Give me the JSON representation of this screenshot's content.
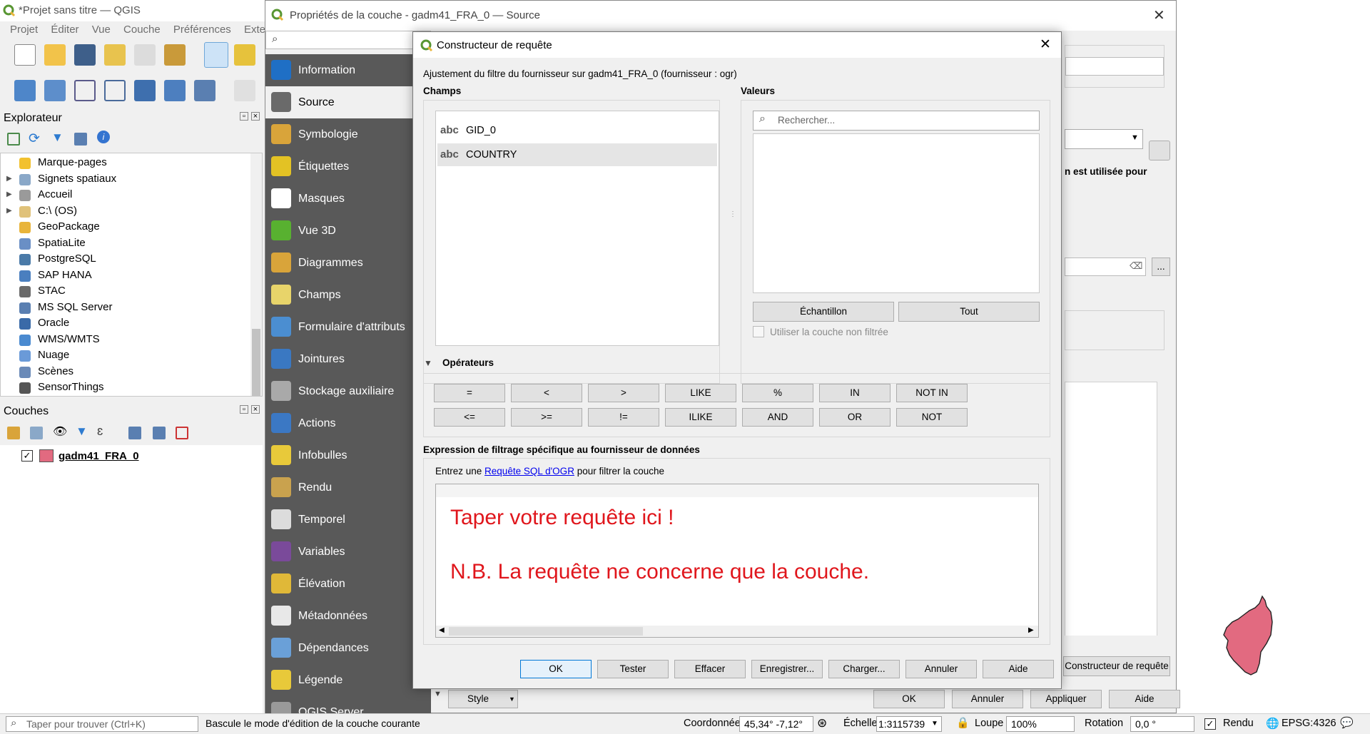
{
  "main": {
    "title": "*Projet sans titre — QGIS",
    "menu": [
      "Projet",
      "Éditer",
      "Vue",
      "Couche",
      "Préférences",
      "Extens"
    ],
    "browser": {
      "title": "Explorateur",
      "items": [
        {
          "label": "Marque-pages",
          "icon": "star-icon",
          "expandable": false
        },
        {
          "label": "Signets spatiaux",
          "icon": "bookmark-icon",
          "expandable": true
        },
        {
          "label": "Accueil",
          "icon": "home-folder-icon",
          "expandable": true
        },
        {
          "label": "C:\\ (OS)",
          "icon": "drive-icon",
          "expandable": true
        },
        {
          "label": "GeoPackage",
          "icon": "geopackage-icon",
          "expandable": false
        },
        {
          "label": "SpatiaLite",
          "icon": "spatialite-icon",
          "expandable": false
        },
        {
          "label": "PostgreSQL",
          "icon": "postgresql-icon",
          "expandable": false
        },
        {
          "label": "SAP HANA",
          "icon": "sap-hana-icon",
          "expandable": false
        },
        {
          "label": "STAC",
          "icon": "stac-icon",
          "expandable": false
        },
        {
          "label": "MS SQL Server",
          "icon": "mssql-icon",
          "expandable": false
        },
        {
          "label": "Oracle",
          "icon": "oracle-icon",
          "expandable": false
        },
        {
          "label": "WMS/WMTS",
          "icon": "wms-icon",
          "expandable": false
        },
        {
          "label": "Nuage",
          "icon": "cloud-icon",
          "expandable": false
        },
        {
          "label": "Scènes",
          "icon": "scenes-icon",
          "expandable": false
        },
        {
          "label": "SensorThings",
          "icon": "sensorthings-icon",
          "expandable": false
        }
      ]
    },
    "layers": {
      "title": "Couches",
      "items": [
        {
          "label": "gadm41_FRA_0",
          "checked": true,
          "color": "#e26a80"
        }
      ]
    }
  },
  "props": {
    "title": "Propriétés de la couche - gadm41_FRA_0 — Source",
    "side_items": [
      {
        "label": "Information",
        "icon": "information-icon",
        "color": "#1f6fc5"
      },
      {
        "label": "Source",
        "icon": "source-icon",
        "color": "#6a6a6a",
        "active": true
      },
      {
        "label": "Symbologie",
        "icon": "symbology-icon",
        "color": "#d9a43a"
      },
      {
        "label": "Étiquettes",
        "icon": "labels-icon",
        "color": "#e3c224"
      },
      {
        "label": "Masques",
        "icon": "masks-icon",
        "color": "#ffffff"
      },
      {
        "label": "Vue 3D",
        "icon": "cube-3d-icon",
        "color": "#58b130"
      },
      {
        "label": "Diagrammes",
        "icon": "diagram-icon",
        "color": "#d9a43a"
      },
      {
        "label": "Champs",
        "icon": "fields-icon",
        "color": "#e8d46a"
      },
      {
        "label": "Formulaire d'attributs",
        "icon": "form-icon",
        "color": "#4b8ed1"
      },
      {
        "label": "Jointures",
        "icon": "joins-icon",
        "color": "#3a78c2"
      },
      {
        "label": "Stockage auxiliaire",
        "icon": "storage-icon",
        "color": "#a9a9a9"
      },
      {
        "label": "Actions",
        "icon": "actions-icon",
        "color": "#3b78c4"
      },
      {
        "label": "Infobulles",
        "icon": "tooltip-icon",
        "color": "#e8c93a"
      },
      {
        "label": "Rendu",
        "icon": "render-brush-icon",
        "color": "#c9a24e"
      },
      {
        "label": "Temporel",
        "icon": "clock-icon",
        "color": "#dcdcdc"
      },
      {
        "label": "Variables",
        "icon": "variables-icon",
        "color": "#7a4a9a"
      },
      {
        "label": "Élévation",
        "icon": "elevation-icon",
        "color": "#e0b838"
      },
      {
        "label": "Métadonnées",
        "icon": "metadata-icon",
        "color": "#e8e8e8"
      },
      {
        "label": "Dépendances",
        "icon": "dependencies-icon",
        "color": "#6aa0d8"
      },
      {
        "label": "Légende",
        "icon": "legend-icon",
        "color": "#e8c93a"
      },
      {
        "label": "QGIS Server",
        "icon": "server-icon",
        "color": "#9a9a9a"
      }
    ],
    "right_partial": {
      "text": "n est utilisée pour",
      "query_builder_btn": "Constructeur de requête",
      "ellipsis": "..."
    },
    "footer": {
      "style": "Style",
      "ok": "OK",
      "cancel": "Annuler",
      "apply": "Appliquer",
      "help": "Aide"
    }
  },
  "qb": {
    "title": "Constructeur de requête",
    "subtitle": "Ajustement du filtre du fournisseur sur gadm41_FRA_0 (fournisseur : ogr)",
    "fields_title": "Champs",
    "fields": [
      {
        "type": "abc",
        "name": "GID_0"
      },
      {
        "type": "abc",
        "name": "COUNTRY"
      }
    ],
    "values_title": "Valeurs",
    "search_placeholder": "Rechercher...",
    "sample": "Échantillon",
    "all": "Tout",
    "unfiltered": "Utiliser la couche non filtrée",
    "operators_title": "Opérateurs",
    "operators_row1": [
      "=",
      "<",
      ">",
      "LIKE",
      "%",
      "IN",
      "NOT IN"
    ],
    "operators_row2": [
      "<=",
      ">=",
      "!=",
      "ILIKE",
      "AND",
      "OR",
      "NOT"
    ],
    "expr_title": "Expression de filtrage spécifique au fournisseur de données",
    "expr_hint_pre": "Entrez une ",
    "expr_hint_link": "Requête SQL d'OGR",
    "expr_hint_post": " pour filtrer la couche",
    "annot_line1": "Taper votre requête ici !",
    "annot_line2": "N.B. La requête ne concerne que la couche.",
    "annot_color": "#e0161c",
    "buttons": {
      "ok": "OK",
      "test": "Tester",
      "clear": "Effacer",
      "save": "Enregistrer...",
      "load": "Charger...",
      "cancel": "Annuler",
      "help": "Aide"
    }
  },
  "status": {
    "search_placeholder": "Taper pour trouver (Ctrl+K)",
    "message": "Bascule le mode d'édition de la couche courante",
    "coord_label": "Coordonnée",
    "coord_value": "45,34° -7,12°",
    "scale_label": "Échelle",
    "scale_value": "1:3115739",
    "magnifier_label": "Loupe",
    "magnifier_value": "100%",
    "rotation_label": "Rotation",
    "rotation_value": "0,0 °",
    "render_label": "Rendu",
    "render_checked": true,
    "crs": "EPSG:4326"
  },
  "colors": {
    "accent": "#0078d7",
    "qgis_green": "#589632",
    "corsica": "#e26a80",
    "sidebar": "#595959"
  }
}
